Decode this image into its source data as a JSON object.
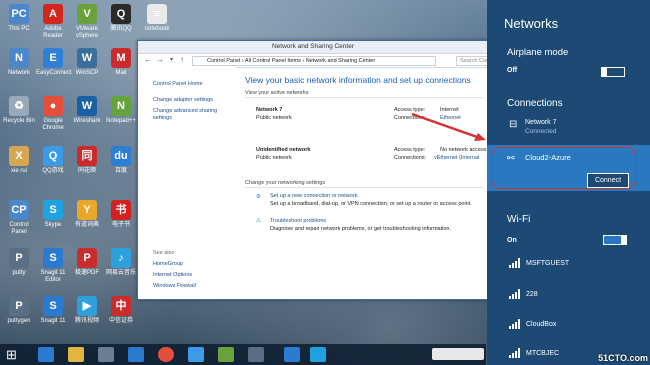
{
  "desktop_icons": [
    {
      "label": "This PC",
      "color": "#4b87c9",
      "glyph": "PC"
    },
    {
      "label": "Adobe Reader",
      "color": "#d3261e",
      "glyph": "A"
    },
    {
      "label": "VMware vSphere",
      "color": "#69a23b",
      "glyph": "V"
    },
    {
      "label": "腾讯QQ",
      "color": "#2a2a2a",
      "glyph": "Q"
    },
    {
      "label": "notebook",
      "color": "#e9e9e9",
      "glyph": "≡"
    },
    {
      "label": "Network",
      "color": "#4b87c9",
      "glyph": "N"
    },
    {
      "label": "EasyConnect",
      "color": "#2e7fd5",
      "glyph": "E"
    },
    {
      "label": "WinSCP",
      "color": "#3a6e9b",
      "glyph": "W"
    },
    {
      "label": "Mail",
      "color": "#c82c2c",
      "glyph": "M"
    },
    {
      "label": "Recycle Bin",
      "color": "#9aa8b8",
      "glyph": "♻"
    },
    {
      "label": "Google Chrome",
      "color": "#e44e3a",
      "glyph": "●"
    },
    {
      "label": "Wireshark",
      "color": "#1b5fa5",
      "glyph": "W"
    },
    {
      "label": "Notepad++",
      "color": "#67a33b",
      "glyph": "N"
    },
    {
      "label": "xie rui",
      "color": "#d6a650",
      "glyph": "X"
    },
    {
      "label": "QQ游戏",
      "color": "#3b9be6",
      "glyph": "Q"
    },
    {
      "label": "同花顺",
      "color": "#c82c2c",
      "glyph": "同"
    },
    {
      "label": "百度",
      "color": "#2d7fd5",
      "glyph": "du"
    },
    {
      "label": "Control Panel",
      "color": "#4b87c9",
      "glyph": "CP"
    },
    {
      "label": "Skype",
      "color": "#1fa3e0",
      "glyph": "S"
    },
    {
      "label": "有道词典",
      "color": "#e9a82a",
      "glyph": "Y"
    },
    {
      "label": "电子书",
      "color": "#d42020",
      "glyph": "书"
    },
    {
      "label": "putty",
      "color": "#5a6f86",
      "glyph": "P"
    },
    {
      "label": "Snagit 11 Editor",
      "color": "#2a7bcf",
      "glyph": "S"
    },
    {
      "label": "极速PDF",
      "color": "#c82c2c",
      "glyph": "P"
    },
    {
      "label": "网易云音乐",
      "color": "#2ea0dc",
      "glyph": "♪"
    },
    {
      "label": "puttygen",
      "color": "#5a6f86",
      "glyph": "P"
    },
    {
      "label": "Snagit 11",
      "color": "#2a7bcf",
      "glyph": "S"
    },
    {
      "label": "腾讯视频",
      "color": "#2ea0dc",
      "glyph": "▶"
    },
    {
      "label": "中信证券",
      "color": "#c82c2c",
      "glyph": "中"
    }
  ],
  "window": {
    "title": "Network and Sharing Center",
    "breadcrumb": [
      "Control Panel",
      "All Control Panel Items",
      "Network and Sharing Center"
    ],
    "search_placeholder": "Search Control Panel",
    "sidebar_top": [
      "Control Panel Home",
      "Change adapter settings",
      "Change advanced sharing settings"
    ],
    "see_also_heading": "See also",
    "see_also": [
      "HomeGroup",
      "Internet Options",
      "Windows Firewall"
    ],
    "main_heading": "View your basic network information and set up connections",
    "active_heading": "View your active networks",
    "networks": [
      {
        "name": "Network  7",
        "type": "Public network",
        "access_label": "Access type:",
        "access": "Internet",
        "conn_label": "Connections:",
        "conn": "Ethernet"
      },
      {
        "name": "Unidentified network",
        "type": "Public network",
        "access_label": "Access type:",
        "access": "No network access",
        "conn_label": "Connections:",
        "conn": "vEthernet (Internal"
      }
    ],
    "change_heading": "Change your networking settings",
    "actions": [
      {
        "link": "Set up a new connection or network",
        "desc": "Set up a broadband, dial-up, or VPN connection; or set up a router or access point."
      },
      {
        "link": "Troubleshoot problems",
        "desc": "Diagnose and repair network problems, or get troubleshooting information."
      }
    ]
  },
  "charm": {
    "title": "Networks",
    "airplane_label": "Airplane mode",
    "airplane_state": "Off",
    "connections_label": "Connections",
    "connections": [
      {
        "name": "Network  7",
        "status": "Connected"
      },
      {
        "name": "Cloud2-Azure",
        "button": "Connect"
      }
    ],
    "wifi_label": "Wi-Fi",
    "wifi_state": "On",
    "wifi_networks": [
      "MSFTGUEST",
      "228",
      "CloudBox",
      "MTCBJEC"
    ]
  },
  "watermark": "51CTO.com",
  "colors": {
    "charm_bg": "#1c4a75",
    "selected": "#2a79c0",
    "highlight_ring": "#d03434",
    "link": "#1e4e8c"
  }
}
